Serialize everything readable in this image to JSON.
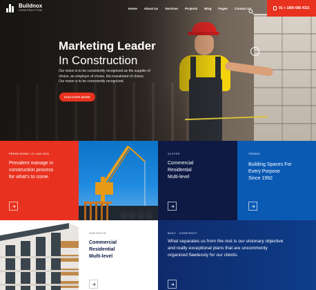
{
  "brand": {
    "name": "Buildnox",
    "tagline": "CONSTRUCTION"
  },
  "nav": {
    "items": [
      "Home",
      "About Us",
      "Services",
      "Projects",
      "Blog",
      "Pages",
      "Contact Us"
    ],
    "phone": "91 + 1800 685 4321"
  },
  "hero": {
    "title_line1": "Marketing Leader",
    "title_line2": "In Construction",
    "desc_lines": [
      "Our vision is to be consistently recognized as the supplier of",
      "choice, an employer of choice, the investment of choice.",
      "Our vision is to be consistently recognized."
    ],
    "cta": "DISCOVER MORE"
  },
  "cards": {
    "press": {
      "kicker": "PRESS ROOM / 21 JAN 2022",
      "lines": [
        "Prevalent manage in",
        "construction  process",
        "for what’s to come."
      ]
    },
    "scope": {
      "kicker": "SCOPER",
      "lines": [
        "Commercial",
        "Residential",
        "Multi-level"
      ]
    },
    "trends": {
      "kicker": "TRENDS",
      "lines": [
        "Building Spaces For",
        "Every Porpose",
        "Since 1992"
      ]
    },
    "facts": {
      "kicker": "OUR FACTS",
      "lines": [
        "Commercial",
        "Residential",
        "Multi-level"
      ]
    },
    "built": {
      "kicker": "BUILT - CONSTRUCT",
      "lines": [
        "What separates us from the rest is our visionary objective",
        "and really exceptional plans that are uncommonly",
        "organized flawlessly for our clients."
      ]
    }
  },
  "colors": {
    "accent": "#e8321f",
    "navy": "#0e1a44",
    "blue": "#0a5ab4"
  },
  "icons": [
    "logo-icon",
    "search-icon",
    "phone-icon",
    "arrow-right-icon"
  ]
}
